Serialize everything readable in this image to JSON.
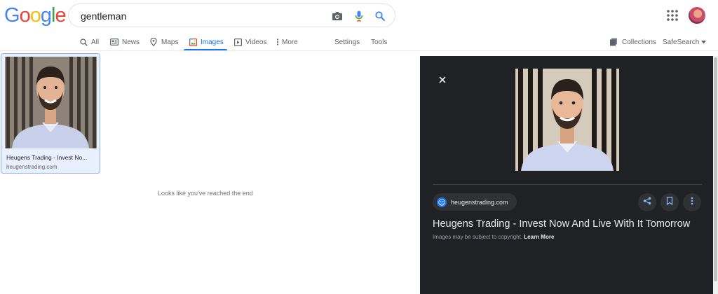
{
  "logo": {
    "letters": [
      "G",
      "o",
      "o",
      "g",
      "l",
      "e"
    ],
    "colors": [
      "#4285f4",
      "#ea4335",
      "#fbbc05",
      "#4285f4",
      "#34a853",
      "#ea4335"
    ]
  },
  "search": {
    "query": "gentleman",
    "icons": [
      "camera-icon",
      "microphone-icon",
      "search-icon"
    ]
  },
  "header": {
    "icons": [
      "apps-grid-icon",
      "avatar"
    ]
  },
  "nav": {
    "tabs": [
      {
        "label": "All",
        "icon": "search-icon"
      },
      {
        "label": "News",
        "icon": "news-icon"
      },
      {
        "label": "Maps",
        "icon": "map-pin-icon"
      },
      {
        "label": "Images",
        "icon": "image-icon",
        "active": true
      },
      {
        "label": "Videos",
        "icon": "play-icon"
      },
      {
        "label": "More",
        "icon": "more-vert-icon"
      }
    ],
    "settings": "Settings",
    "tools": "Tools",
    "collections": "Collections",
    "safesearch": "SafeSearch"
  },
  "result": {
    "title": "Heugens Trading - Invest No...",
    "domain": "heugenstrading.com"
  },
  "end_message": "Looks like you've reached the end",
  "panel": {
    "source": "heugenstrading.com",
    "title": "Heugens Trading - Invest Now And Live With It Tomorrow",
    "copyright": "Images may be subject to copyright.",
    "learn_more": "Learn More",
    "actions": [
      "share-icon",
      "bookmark-icon",
      "more-vert-icon"
    ]
  },
  "colors": {
    "accent": "#1a73e8",
    "panel_bg": "#202124",
    "selected_bg": "#e8f0fe"
  }
}
